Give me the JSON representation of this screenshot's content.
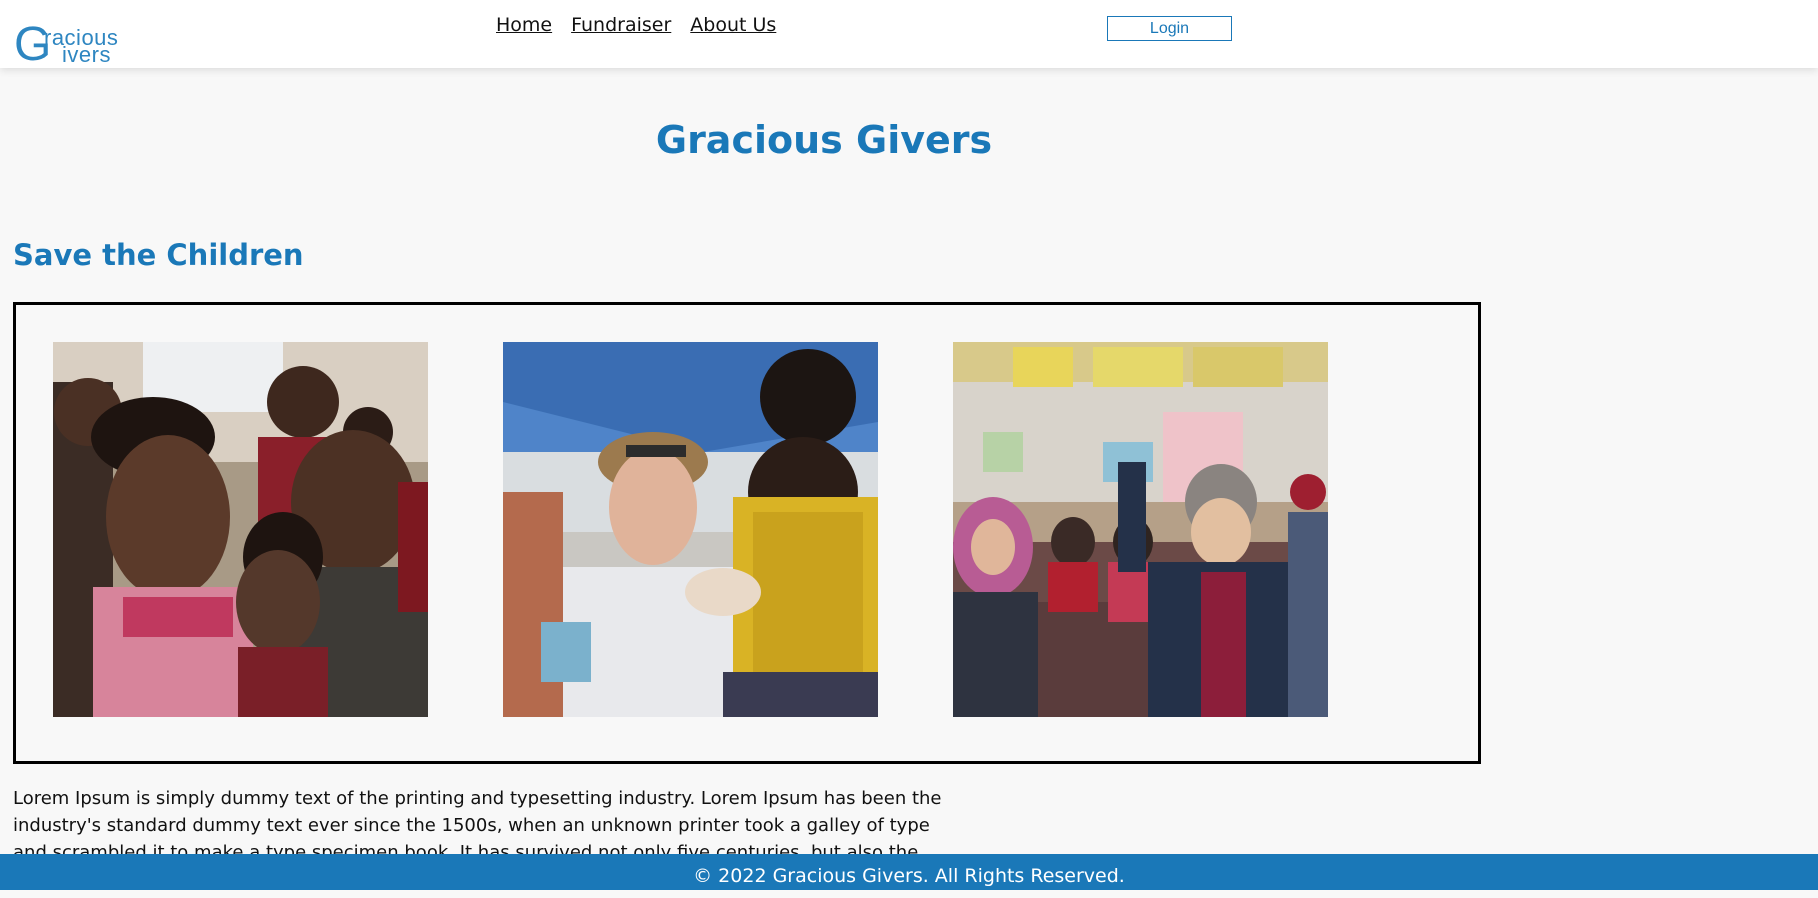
{
  "header": {
    "logo": {
      "letter": "G",
      "line1": "racious",
      "line2": "ivers"
    },
    "nav": [
      {
        "label": "Home"
      },
      {
        "label": "Fundraiser"
      },
      {
        "label": "About Us"
      }
    ],
    "login_label": "Login"
  },
  "main": {
    "site_title": "Gracious Givers",
    "section_title": "Save the Children",
    "gallery": [
      {
        "icon": "children-smiling-photo"
      },
      {
        "icon": "aid-worker-with-child-photo"
      },
      {
        "icon": "classroom-children-photo"
      }
    ],
    "body_text": "Lorem Ipsum is simply dummy text of the printing and typesetting industry. Lorem Ipsum has been the industry's standard dummy text ever since the 1500s, when an unknown printer took a galley of type and scrambled it to make a type specimen book. It has survived not only five centuries, but also the leap into electronic typesetting, remaining essentially unchanged."
  },
  "footer": {
    "text": "© 2022 Gracious Givers. All Rights Reserved."
  },
  "colors": {
    "brand_blue": "#1a78b8",
    "page_bg": "#f8f8f8",
    "header_bg": "#ffffff"
  }
}
